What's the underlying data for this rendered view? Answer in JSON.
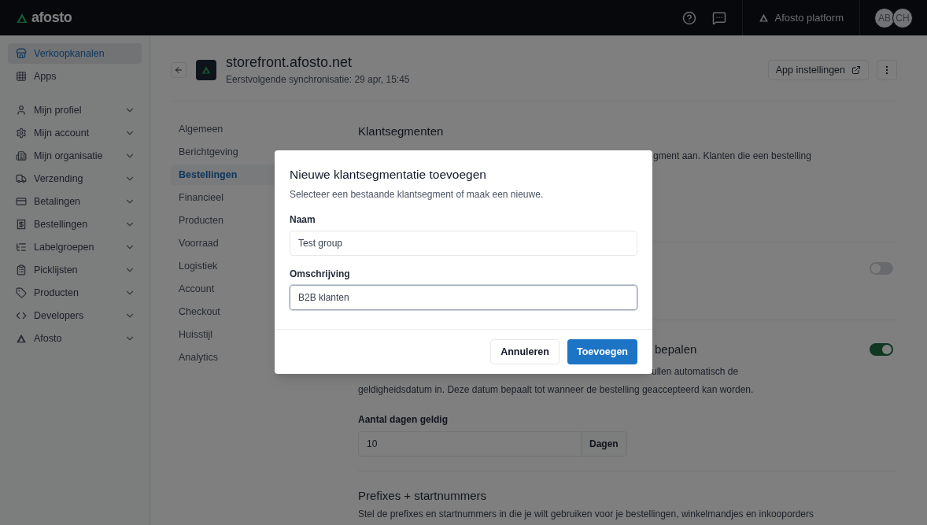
{
  "topbar": {
    "logo": "afosto",
    "platform": "Afosto platform",
    "avatars": [
      "AB",
      "CH"
    ]
  },
  "sidebar": {
    "items": [
      {
        "label": "Verkoopkanalen",
        "selected": true,
        "expandable": false
      },
      {
        "label": "Apps",
        "selected": false,
        "expandable": false
      },
      {
        "label": "Mijn profiel",
        "selected": false,
        "expandable": true
      },
      {
        "label": "Mijn account",
        "selected": false,
        "expandable": true
      },
      {
        "label": "Mijn organisatie",
        "selected": false,
        "expandable": true
      },
      {
        "label": "Verzending",
        "selected": false,
        "expandable": true
      },
      {
        "label": "Betalingen",
        "selected": false,
        "expandable": true
      },
      {
        "label": "Bestellingen",
        "selected": false,
        "expandable": true
      },
      {
        "label": "Labelgroepen",
        "selected": false,
        "expandable": true
      },
      {
        "label": "Picklijsten",
        "selected": false,
        "expandable": true
      },
      {
        "label": "Producten",
        "selected": false,
        "expandable": true
      },
      {
        "label": "Developers",
        "selected": false,
        "expandable": true
      },
      {
        "label": "Afosto",
        "selected": false,
        "expandable": true
      }
    ]
  },
  "header": {
    "title": "storefront.afosto.net",
    "subtitle": "Eerstvolgende synchronisatie: 29 apr, 15:45",
    "settings_button": "App instellingen"
  },
  "subnav": [
    {
      "label": "Algemeen",
      "selected": false
    },
    {
      "label": "Berichtgeving",
      "selected": false
    },
    {
      "label": "Bestellingen",
      "selected": true
    },
    {
      "label": "Financieel",
      "selected": false
    },
    {
      "label": "Producten",
      "selected": false
    },
    {
      "label": "Voorraad",
      "selected": false
    },
    {
      "label": "Logistiek",
      "selected": false
    },
    {
      "label": "Account",
      "selected": false
    },
    {
      "label": "Checkout",
      "selected": false
    },
    {
      "label": "Huisstijl",
      "selected": false
    },
    {
      "label": "Analytics",
      "selected": false
    }
  ],
  "sections": {
    "segments_title": "Klantsegmenten",
    "segments_text_fragment": "gment aan. Klanten die een bestelling",
    "toggle_1": {
      "on": false
    },
    "validity_title_fragment": "bepalen",
    "toggle_2": {
      "on": true
    },
    "validity_text_fragment": "ullen automatisch de",
    "validity_text_line_2": "geldigheidsdatum in. Deze datum bepaalt tot wanneer de bestelling geaccepteerd kan worden.",
    "days_label": "Aantal dagen geldig",
    "days_value": "10",
    "days_unit": "Dagen",
    "prefix_title": "Prefixes + startnummers",
    "prefix_text": "Stel de prefixes en startnummers in die je wilt gebruiken voor je bestellingen, winkelmandjes en inkooporders"
  },
  "dialog": {
    "title": "Nieuwe klantsegmentatie toevoegen",
    "description": "Selecteer een bestaande klantsegment of maak een nieuwe.",
    "fields": [
      {
        "label": "Naam",
        "value": "Test group",
        "focused": false
      },
      {
        "label": "Omschrijving",
        "value": "B2B klanten",
        "focused": true
      }
    ],
    "cancel": "Annuleren",
    "submit": "Toevoegen"
  }
}
